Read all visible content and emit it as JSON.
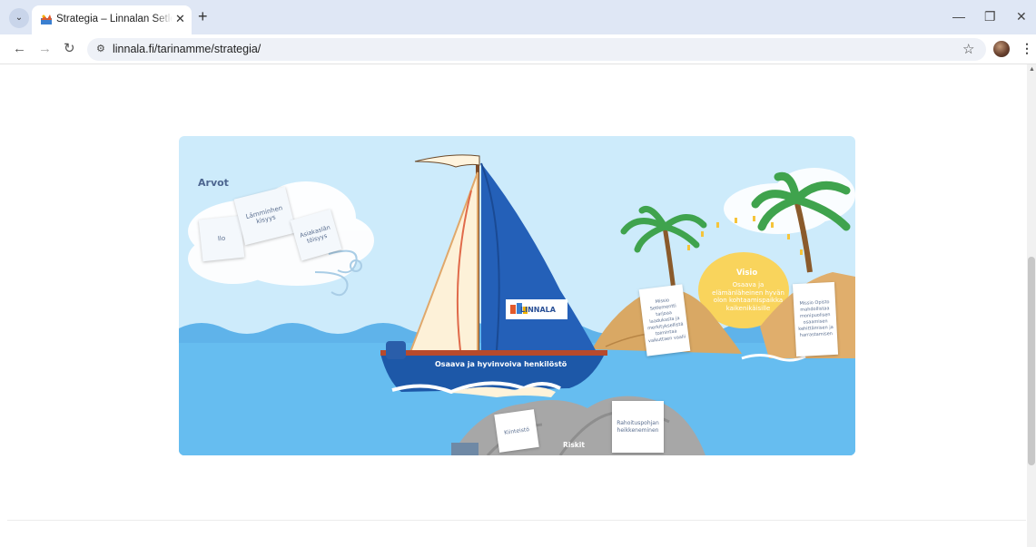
{
  "browser": {
    "tab_title": "Strategia – Linnalan Setlementti",
    "tab_close": "✕",
    "new_tab": "+",
    "tab_menu": "⌄",
    "url": "linnala.fi/tarinamme/strategia/",
    "window_controls": {
      "minimize": "—",
      "restore": "❐",
      "close": "✕"
    },
    "nav": {
      "back": "←",
      "forward": "→",
      "reload": "↻"
    },
    "site_info_icon": "⚙",
    "bookmark_icon": "☆",
    "menu_icon": "⋮"
  },
  "scene": {
    "values_title": "Arvot",
    "values": [
      "Ilo",
      "Lämminhenkisyys",
      "Asiakaslähtöisyys"
    ],
    "values_display": [
      "Ilo",
      "Lämminhen\nkisyys",
      "Asiakaslän\ntöisyys"
    ],
    "boat_banner": "Osaava ja hyvinvoiva henkilöstö",
    "sail_logo": "LINNALA",
    "vision": {
      "title": "Visio",
      "text": "Osaava ja elämänläheinen hyvän olon kohtaamispaikka kaikenikäisille"
    },
    "mission_card_1": "Missio Setlementti tarjoaa laadukasta ja merkityksellistä toimintaa vaikuttaen vaalii",
    "mission_card_2": "Missio Opisto mahdollistaa monipuolisen osaamisen kehittämisen ja harrastamisen",
    "risks_title": "Riskit",
    "risks": [
      "Kiinteistö",
      "Rahoituspohjan heikkeneminen"
    ]
  }
}
